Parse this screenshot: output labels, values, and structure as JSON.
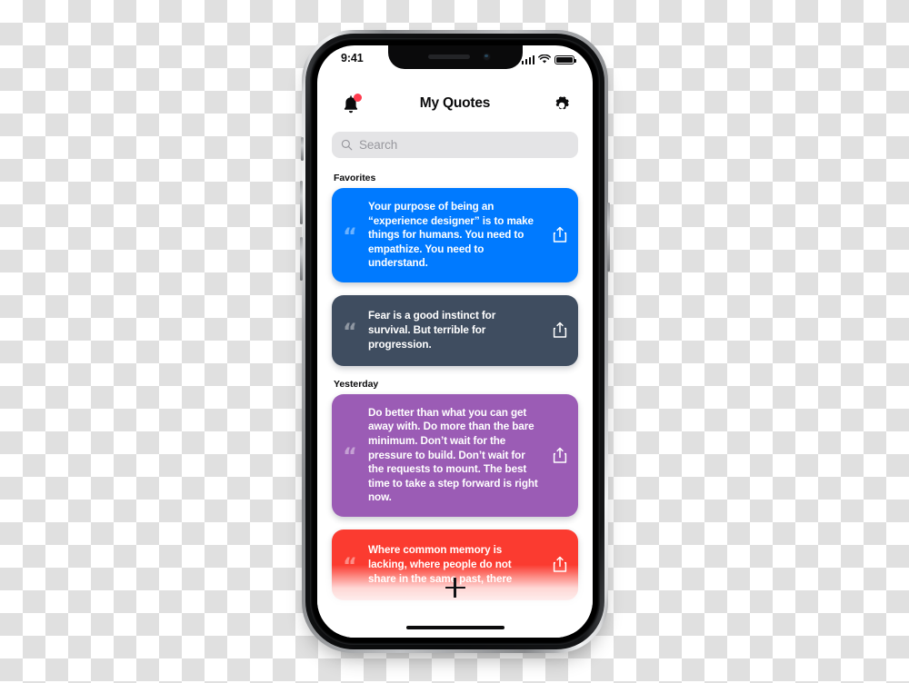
{
  "status_bar": {
    "time": "9:41",
    "signal_icon": "cellular-signal-icon",
    "wifi_icon": "wifi-icon",
    "battery_icon": "battery-icon"
  },
  "header": {
    "title": "My Quotes",
    "bell_icon": "bell-icon",
    "bell_badge": true,
    "gear_icon": "gear-icon"
  },
  "search": {
    "placeholder": "Search",
    "value": "",
    "icon": "search-icon"
  },
  "sections": [
    {
      "label": "Favorites",
      "cards": [
        {
          "text": "Your purpose of being an “experience designer” is to make things for humans. You need to empathize. You need to understand.",
          "color": "#007aff",
          "quote_mark": "“",
          "share_icon": "share-icon"
        },
        {
          "text": "Fear is a good instinct for survival. But terrible for progression.",
          "color": "#3f4d60",
          "quote_mark": "“",
          "share_icon": "share-icon"
        }
      ]
    },
    {
      "label": "Yesterday",
      "cards": [
        {
          "text": "Do better than what you can get away with. Do more than the bare minimum. Don’t wait for the pressure to build. Don’t wait for the requests to mount. The best time to take a step forward is right now.",
          "color": "#9b5cb5",
          "quote_mark": "“",
          "share_icon": "share-icon"
        },
        {
          "text": "Where common memory is lacking, where people do not share in the same past, there",
          "color": "#fb3b30",
          "quote_mark": "“",
          "share_icon": "share-icon"
        }
      ]
    }
  ],
  "add_button": {
    "icon": "plus-icon",
    "label": "+"
  },
  "home_indicator": "home-indicator",
  "colors": {
    "accent_blue": "#007aff",
    "slate": "#3f4d60",
    "purple": "#9b5cb5",
    "red": "#fb3b30",
    "badge_red": "#ff3b4e",
    "search_bg": "#e4e4e6",
    "screen_bg": "#ffffff"
  }
}
